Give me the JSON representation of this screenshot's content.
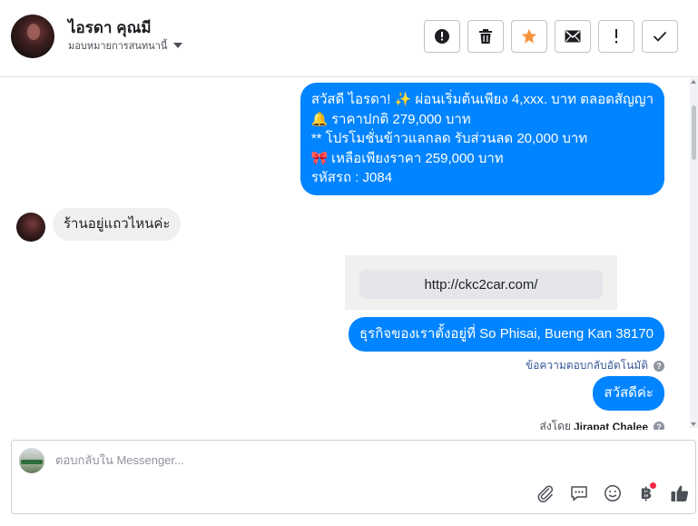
{
  "header": {
    "contact_name": "ไอรดา คุณมี",
    "assign_label": "มอบหมายการสนทนานี้",
    "actions": [
      {
        "name": "spam-button",
        "icon": "alert-circle-icon"
      },
      {
        "name": "delete-button",
        "icon": "trash-icon"
      },
      {
        "name": "star-button",
        "icon": "star-icon",
        "color": "#f7923b"
      },
      {
        "name": "mark-unread-button",
        "icon": "envelope-icon"
      },
      {
        "name": "follow-up-button",
        "icon": "exclamation-icon"
      },
      {
        "name": "mark-done-button",
        "icon": "check-icon"
      }
    ]
  },
  "messages": {
    "promo": {
      "line1": "สวัสดี ไอรดา! ✨  ผ่อนเริ่มต้นเพียง 4,xxx. บาท ตลอดสัญญา",
      "line2_emoji": "🔔",
      "line2": " ราคาปกติ 279,000 บาท",
      "line3": "** โปรโมชั่นข้าวแลกลด รับส่วนลด 20,000 บาท",
      "line4_emoji": "🎀",
      "line4": "  เหลือเพียงราคา 259,000 บาท",
      "line5": " รหัสรถ : J084"
    },
    "customer_question": "ร้านอยู่แถวไหนค่ะ",
    "link_card_url": "http://ckc2car.com/",
    "address": "ธุรกิจของเราตั้งอยู่ที่ So Phisai, Bueng Kan 38170",
    "auto_reply_label": "ข้อความตอบกลับอัตโนมัติ",
    "greeting": "สวัสดีค่ะ",
    "sent_by_label": "ส่งโดย",
    "sent_by_name": "Jirapat Chalee"
  },
  "composer": {
    "placeholder": "ตอบกลับใน Messenger...",
    "value": "",
    "icons": [
      "attachment-icon",
      "saved-replies-icon",
      "emoji-icon",
      "payment-icon",
      "like-icon"
    ],
    "payment_glyph": "฿"
  },
  "colors": {
    "outgoing_bubble": "#0084ff",
    "incoming_bubble": "#f0f0f0",
    "star_accent": "#f7923b",
    "notification_dot": "#f02849"
  }
}
